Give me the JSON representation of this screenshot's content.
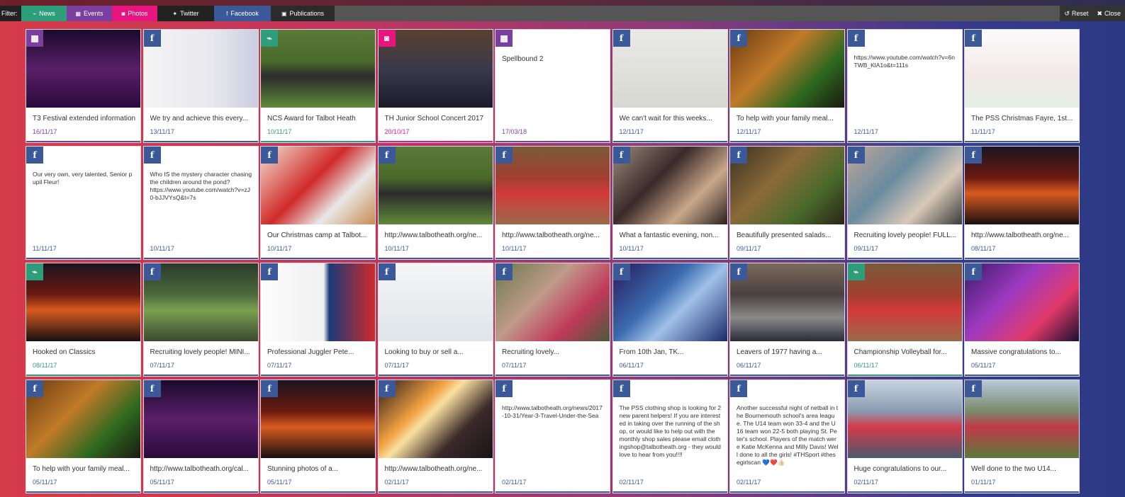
{
  "filter": {
    "label": "Filter:",
    "tabs": [
      {
        "label": "News",
        "icon": "rss-icon",
        "glyph": "⌁"
      },
      {
        "label": "Events",
        "icon": "calendar-icon",
        "glyph": "▦"
      },
      {
        "label": "Photos",
        "icon": "camera-icon",
        "glyph": "◙"
      },
      {
        "label": "Twitter",
        "icon": "twitter-icon",
        "glyph": "✦"
      },
      {
        "label": "Facebook",
        "icon": "facebook-icon",
        "glyph": "f"
      },
      {
        "label": "Publications",
        "icon": "book-icon",
        "glyph": "▣"
      }
    ],
    "reset_label": "Reset",
    "close_label": "Close"
  },
  "colors": {
    "news": "#2e9e7a",
    "events": "#7b3fa0",
    "photos": "#e8157e",
    "facebook": "#3b5998",
    "twitter": "#222222"
  },
  "cards": [
    {
      "type": "events",
      "title": "T3 Festival extended information",
      "date": "16/11/17",
      "image": "concert-crowd-purple"
    },
    {
      "type": "facebook",
      "title": "We try and achieve this every...",
      "date": "13/11/17",
      "image": "word-action-poster"
    },
    {
      "type": "news",
      "title": "NCS Award for Talbot Heath",
      "date": "10/11/17",
      "image": "girls-group-grass"
    },
    {
      "type": "photos",
      "title": "TH Junior School Concert 2017",
      "date": "20/10/17",
      "image": "hall-concert"
    },
    {
      "type": "events",
      "title": "Spellbound 2",
      "date": "17/03/18",
      "image": ""
    },
    {
      "type": "facebook",
      "title": "We can't wait for this weeks...",
      "date": "12/11/17",
      "image": "menu-board"
    },
    {
      "type": "facebook",
      "title": "To help with your family meal...",
      "date": "12/11/17",
      "image": "food-platter"
    },
    {
      "type": "facebook",
      "title": "",
      "date": "12/11/17",
      "image": "",
      "text": "https://www.youtube.com/watch?v=6nTWB_KlA1o&t=111s"
    },
    {
      "type": "facebook",
      "title": "The PSS Christmas Fayre, 1st...",
      "date": "11/11/17",
      "image": "christmas-market-poster"
    },
    {
      "type": "facebook",
      "title": "",
      "date": "11/11/17",
      "image": "",
      "text": "Our very own, very talented, Senior pupil Fleur!"
    },
    {
      "type": "facebook",
      "title": "",
      "date": "10/11/17",
      "image": "",
      "text": "Who IS the mystery character chasing the children around the pond?\nhttps://www.youtube.com/watch?v=zJ0-bJJVYsQ&t=7s"
    },
    {
      "type": "facebook",
      "title": "Our Christmas camp at Talbot...",
      "date": "10/11/17",
      "image": "child-santa-hat"
    },
    {
      "type": "facebook",
      "title": "http://www.talbotheath.org/ne...",
      "date": "10/11/17",
      "image": "girls-group-grass"
    },
    {
      "type": "facebook",
      "title": "http://www.talbotheath.org/ne...",
      "date": "10/11/17",
      "image": "volleyball-team"
    },
    {
      "type": "facebook",
      "title": "What a fantastic evening, non...",
      "date": "10/11/17",
      "image": "people-evening"
    },
    {
      "type": "facebook",
      "title": "Beautifully presented salads...",
      "date": "09/11/17",
      "image": "salad-dishes"
    },
    {
      "type": "facebook",
      "title": "Recruiting lovely people! FULL...",
      "date": "09/11/17",
      "image": "art-portraits"
    },
    {
      "type": "facebook",
      "title": "http://www.talbotheath.org/ne...",
      "date": "08/11/17",
      "image": "building-night-red"
    },
    {
      "type": "news",
      "title": "Hooked on Classics",
      "date": "08/11/17",
      "image": "building-night-red"
    },
    {
      "type": "facebook",
      "title": "Recruiting lovely people! MINI...",
      "date": "07/11/17",
      "image": "garden-pond"
    },
    {
      "type": "facebook",
      "title": "Professional Juggler Pete...",
      "date": "07/11/17",
      "image": "bake-show-poster"
    },
    {
      "type": "facebook",
      "title": "Looking to buy or sell a...",
      "date": "07/11/17",
      "image": "recent-ads-page"
    },
    {
      "type": "facebook",
      "title": "Recruiting lovely...",
      "date": "07/11/17",
      "image": "face-paint-child"
    },
    {
      "type": "facebook",
      "title": "From 10th Jan, TK...",
      "date": "06/11/17",
      "image": "blue-sparkle"
    },
    {
      "type": "facebook",
      "title": "Leavers of 1977 having a...",
      "date": "06/11/17",
      "image": "woman-portrait"
    },
    {
      "type": "news",
      "title": "Championship Volleyball for...",
      "date": "06/11/17",
      "image": "volleyball-team"
    },
    {
      "type": "facebook",
      "title": "Massive congratulations to...",
      "date": "05/11/17",
      "image": "purple-party"
    },
    {
      "type": "facebook",
      "title": "To help with your family meal...",
      "date": "05/11/17",
      "image": "food-platter"
    },
    {
      "type": "facebook",
      "title": "http://www.talbotheath.org/cal...",
      "date": "05/11/17",
      "image": "concert-crowd-purple"
    },
    {
      "type": "facebook",
      "title": "Stunning photos of a...",
      "date": "05/11/17",
      "image": "building-night-red"
    },
    {
      "type": "facebook",
      "title": "http://www.talbotheath.org/ne...",
      "date": "02/11/17",
      "image": "fire-science"
    },
    {
      "type": "facebook",
      "title": "",
      "date": "02/11/17",
      "image": "",
      "text": "http://www.talbotheath.org/news/2017-10-31/Year-3-Travel-Under-the-Sea"
    },
    {
      "type": "facebook",
      "title": "",
      "date": "02/11/17",
      "image": "",
      "text": "The PSS clothing shop is looking for 2 new parent helpers! If you are interested in taking over the running of the shop, or would like to help out with the monthly shop sales please email clothingshop@talbotheath.org - they would love to hear from you!!!!"
    },
    {
      "type": "facebook",
      "title": "",
      "date": "02/11/17",
      "image": "",
      "text": "Another successful night of netball in the Bournemouth school's area league. The U14 team won 33-4 and the U16 team won 22-5 both playing St. Peter's school. Players of the match were Katie McKenna and Milly Davis! Well done to all the girls! #THSport #thesegirlscan 💙❤️👍🏻"
    },
    {
      "type": "facebook",
      "title": "Huge congratulations to our...",
      "date": "02/11/17",
      "image": "netball-team-court"
    },
    {
      "type": "facebook",
      "title": "Well done to the two U14...",
      "date": "01/11/17",
      "image": "netball-team-field"
    }
  ]
}
